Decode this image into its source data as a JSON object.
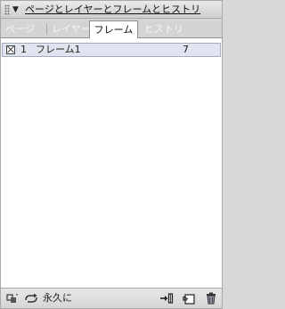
{
  "panel": {
    "title": "ページとレイヤーとフレームとヒストリ"
  },
  "tabs": [
    {
      "label": "ページ",
      "active": false
    },
    {
      "label": "レイヤー",
      "active": false
    },
    {
      "label": "フレーム",
      "active": true
    },
    {
      "label": "ヒストリ",
      "active": false
    }
  ],
  "frames": [
    {
      "number": "1",
      "name": "フレーム1",
      "delay": "7",
      "selected": true
    }
  ],
  "footer": {
    "loop_label": "永久に",
    "icons": [
      "onion-skin-icon",
      "loop-icon",
      "distribute-to-frames-icon",
      "new-frame-icon",
      "trash-icon"
    ]
  }
}
